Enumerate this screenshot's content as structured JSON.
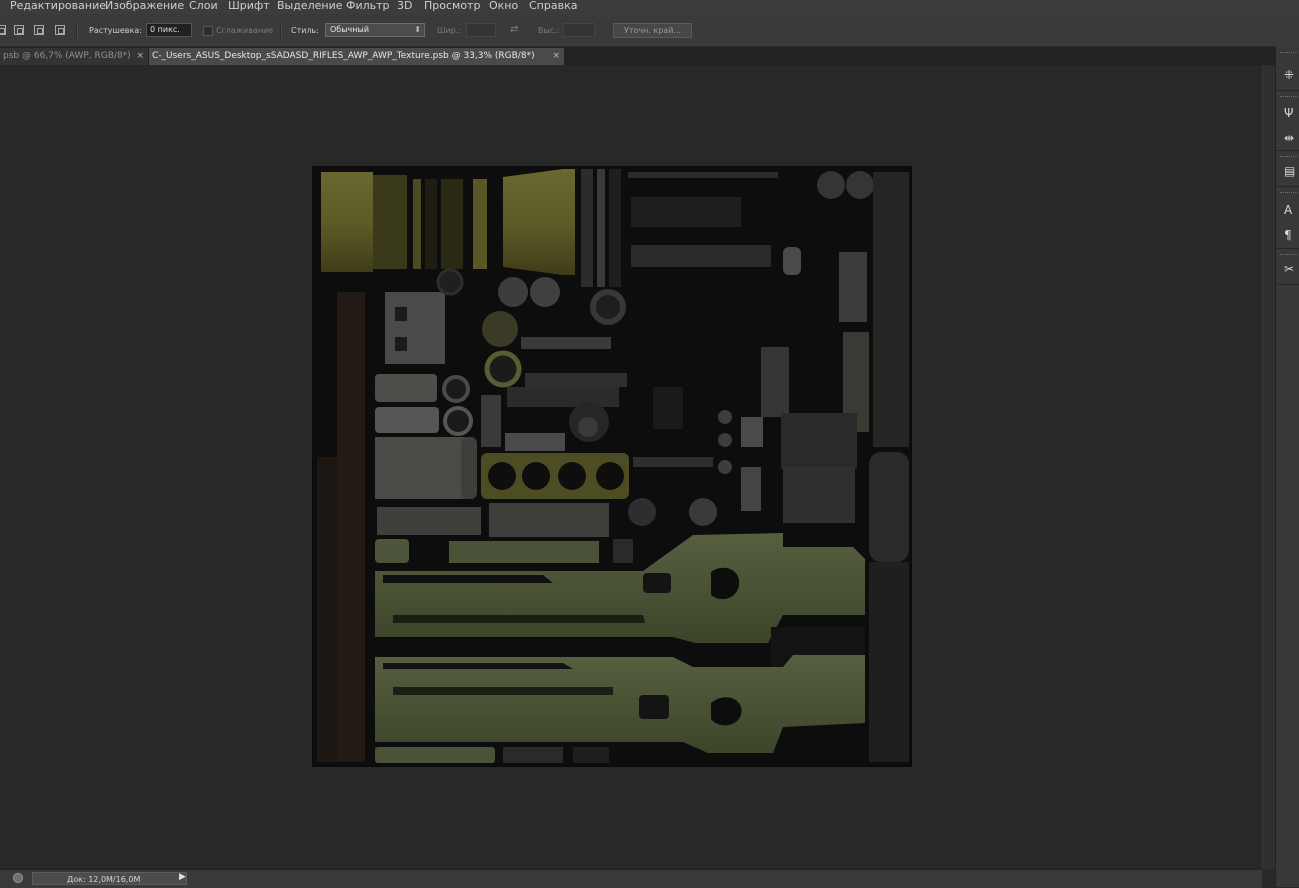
{
  "menu": {
    "items": [
      "Редактирование",
      "Изображение",
      "Слои",
      "Шрифт",
      "Выделение",
      "Фильтр",
      "3D",
      "Просмотр",
      "Окно",
      "Справка"
    ]
  },
  "options": {
    "feather_label": "Растушевка:",
    "feather_value": "0 пикс.",
    "antialias_label": "Сглаживание",
    "style_label": "Стиль:",
    "style_value": "Обычный",
    "width_label": "Шир.:",
    "height_label": "Выс.:",
    "refine_edge_label": "Уточн. край..."
  },
  "tabs": [
    {
      "label": "psb @ 66,7% (AWP, RGB/8*)",
      "close": "×",
      "active": false
    },
    {
      "label": "C-_Users_ASUS_Desktop_sSADASD_RIFLES_AWP_AWP_Texture.psb @ 33,3% (RGB/8*)",
      "close": "×",
      "active": true
    }
  ],
  "status": {
    "doc_size": "Док: 12,0M/16,0M",
    "play": "▶"
  },
  "dock": {
    "icons": [
      "history-icon",
      "brush-settings-icon",
      "adjustments-icon",
      "layers-icon",
      "character-icon",
      "paragraph-icon",
      "tools-icon"
    ],
    "glyphs": [
      "⁜",
      "Ψ",
      "⇹",
      "▤",
      "A",
      "¶",
      "✂"
    ]
  },
  "colors": {
    "olive_green": "#4a5236",
    "yellow_olive": "#5a5a22",
    "canvas_bg": "#0c0c0c",
    "workspace": "#282828"
  }
}
